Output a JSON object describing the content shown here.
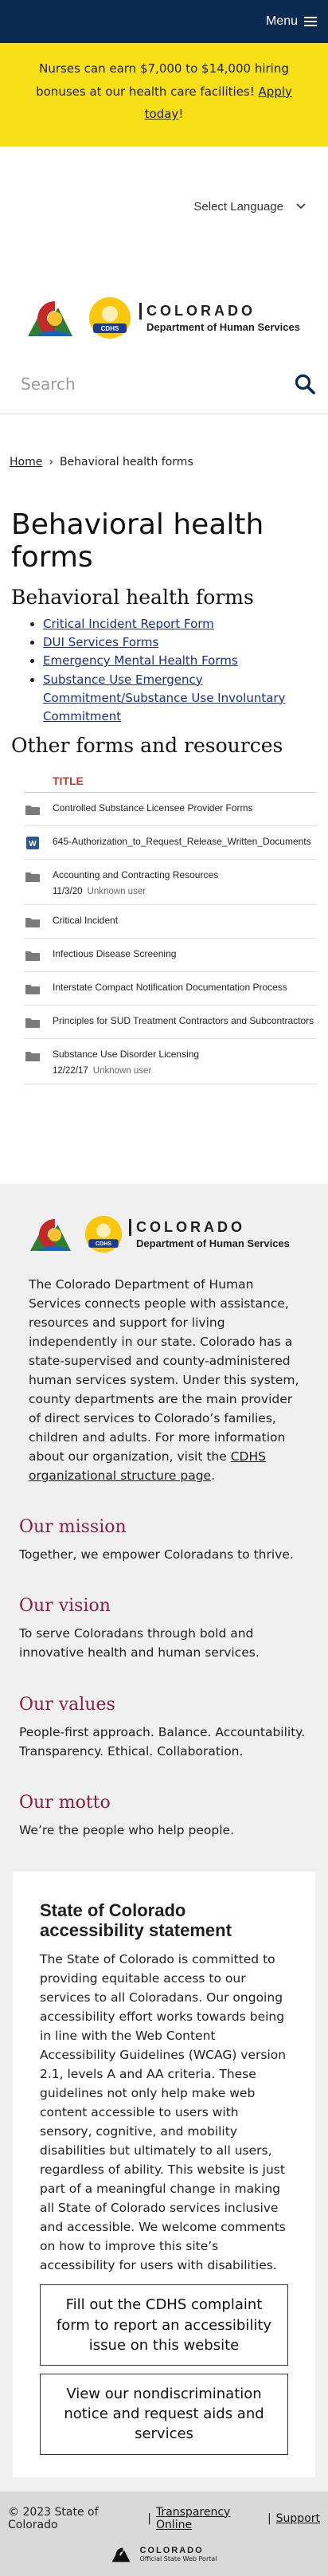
{
  "header": {
    "menu_label": "Menu"
  },
  "banner": {
    "text_before": "Nurses can earn $7,000 to $14,000 hiring bonuses at our health care facilities! ",
    "link_text": "Apply today",
    "text_after": "!"
  },
  "language": {
    "selected": "Select Language"
  },
  "logo": {
    "state": "COLORADO",
    "dept": "Department of Human Services",
    "badge": "CDHS"
  },
  "search": {
    "placeholder": "Search"
  },
  "breadcrumb": {
    "home": "Home",
    "separator": "›",
    "current": "Behavioral health forms"
  },
  "main": {
    "title": "Behavioral health forms",
    "section1_title": "Behavioral health forms",
    "links": [
      "Critical Incident Report Form",
      "DUI Services Forms",
      "Emergency Mental Health Forms",
      "Substance Use Emergency Commitment/Substance Use Involuntary Commitment"
    ],
    "section2_title": "Other forms and resources"
  },
  "documents": {
    "column_title": "TITLE",
    "rows": [
      {
        "icon": "folder-icon",
        "title": "Controlled Substance Licensee Provider Forms",
        "date": "",
        "author": ""
      },
      {
        "icon": "word-doc-icon",
        "title": "645-Authorization_to_Request_Release_Written_Documents",
        "date": "",
        "author": ""
      },
      {
        "icon": "folder-icon",
        "title": "Accounting and Contracting Resources",
        "date": "11/3/20",
        "author": "Unknown user"
      },
      {
        "icon": "folder-icon",
        "title": "Critical Incident",
        "date": "",
        "author": ""
      },
      {
        "icon": "folder-icon",
        "title": "Infectious Disease Screening",
        "date": "",
        "author": ""
      },
      {
        "icon": "folder-icon",
        "title": "Interstate Compact Notification Documentation Process",
        "date": "",
        "author": ""
      },
      {
        "icon": "folder-icon",
        "title": "Principles for SUD Treatment Contractors and Subcontractors",
        "date": "",
        "author": ""
      },
      {
        "icon": "folder-icon",
        "title": "Substance Use Disorder Licensing",
        "date": "12/22/17",
        "author": "Unknown user"
      }
    ]
  },
  "footer": {
    "about_text": "The Colorado Department of Human Services connects people with assistance, resources and support for living independently in our state. Colorado has a state-supervised and county-administered human services system. Under this system, county departments are the main provider of direct services to Colorado’s families, children and adults. For more information about our organization, visit the ",
    "about_link": "CDHS organizational structure page",
    "about_end": ".",
    "mission_title": "Our mission",
    "mission_text": "Together, we empower Coloradans to thrive.",
    "vision_title": "Our vision",
    "vision_text": "To serve Coloradans through bold and innovative health and human services.",
    "values_title": "Our values",
    "values_text": "People-first approach. Balance. Accountability. Transparency. Ethical. Collaboration.",
    "motto_title": "Our motto",
    "motto_text": "We’re the people who help people.",
    "a11y_title": "State of Colorado accessibility statement",
    "a11y_text": "The State of Colorado is committed to providing equitable access to our services to all Coloradans. Our ongoing accessibility effort works towards being in line with the Web Content Accessibility Guidelines (WCAG) version 2.1, levels A and AA criteria. These guidelines not only help make web content accessible to users with sensory, cognitive, and mobility disabilities but ultimately to all users, regardless of ability. This website is just part of a meaningful change in making all State of Colorado services inclusive and accessible. We welcome comments on how to improve this site’s accessibility for users with disabilities.",
    "a11y_button1": "Fill out the CDHS complaint form to report an accessibility issue on this website",
    "a11y_button2": "View our nondiscrimination notice and request aids and services",
    "copyright": "© 2023 State of Colorado",
    "link_transparency": "Transparency Online",
    "link_support": "Support",
    "divider": "|",
    "portal_name": "COLORADO",
    "portal_sub": "Official State Web Portal"
  },
  "colors": {
    "header_bg": "#0b2a4f",
    "banner_bg": "#f7e018",
    "link": "#1a2f8a",
    "doc_header": "#c0392b",
    "footer_heading": "#8c1d3f"
  }
}
